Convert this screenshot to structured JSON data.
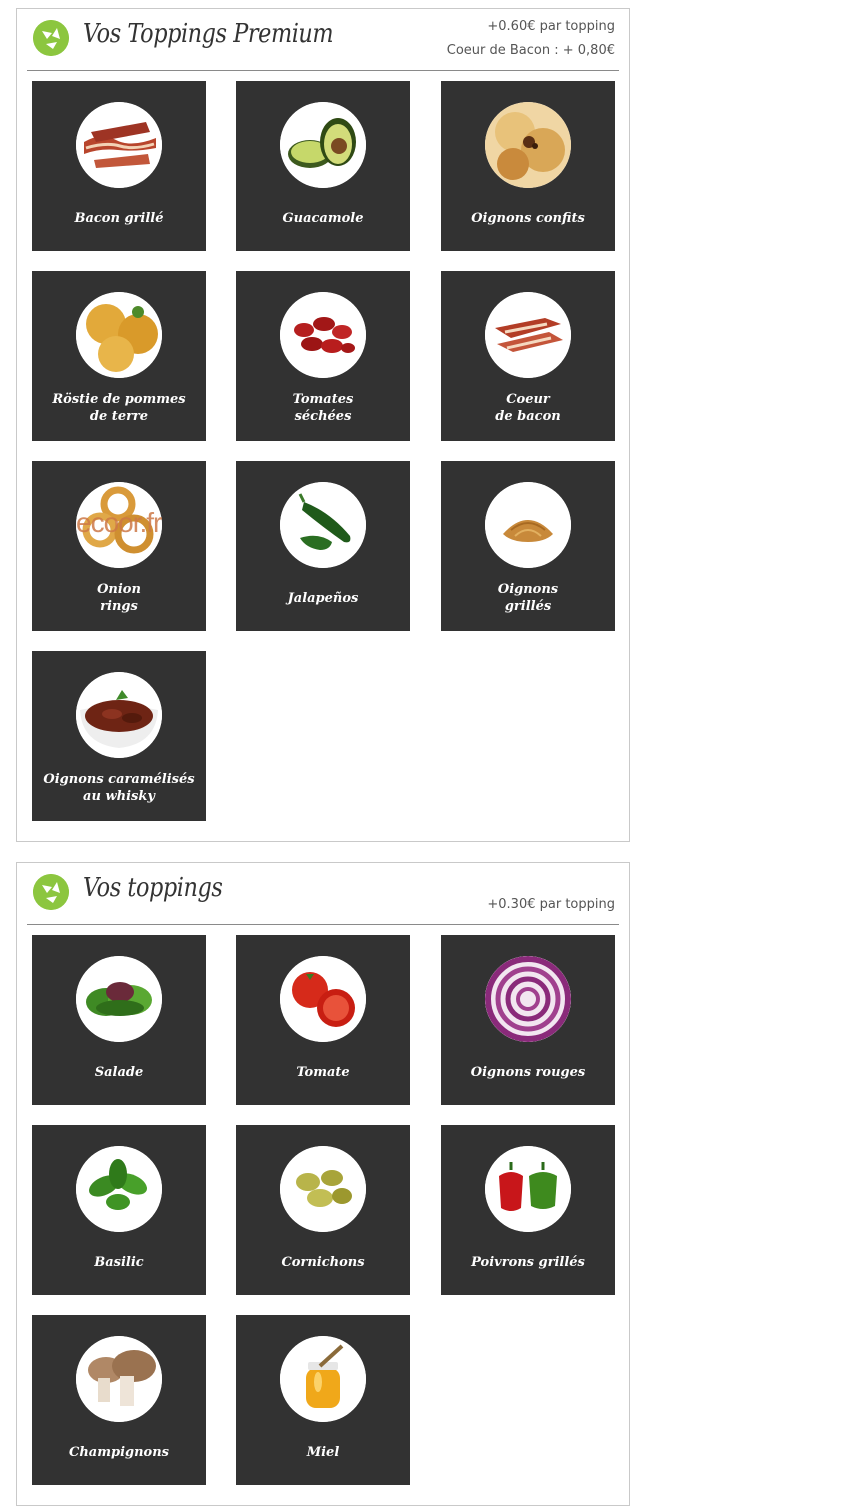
{
  "premium": {
    "title": "Vos Toppings Premium",
    "price_line_1": "+0.60€ par topping",
    "price_line_2": "Coeur de Bacon : + 0,80€",
    "items": [
      {
        "label": "Bacon grillé",
        "icon": "bacon-icon"
      },
      {
        "label": "Guacamole",
        "icon": "avocado-icon"
      },
      {
        "label": "Oignons confits",
        "icon": "confit-onion-icon"
      },
      {
        "label": "Röstie de pommes\nde terre",
        "icon": "rosti-icon"
      },
      {
        "label": "Tomates\nséchées",
        "icon": "dried-tomato-icon"
      },
      {
        "label": "Coeur\nde bacon",
        "icon": "bacon-heart-icon"
      },
      {
        "label": "Onion\nrings",
        "icon": "onion-rings-icon"
      },
      {
        "label": "Jalapeños",
        "icon": "jalapeno-icon"
      },
      {
        "label": "Oignons\ngrillés",
        "icon": "fried-onion-icon"
      },
      {
        "label": "Oignons caramélisés\nau whisky",
        "icon": "caramelized-onion-icon"
      }
    ],
    "watermark": "ecoor.fr"
  },
  "standard": {
    "title": "Vos toppings",
    "price_line_1": "+0.30€ par topping",
    "items": [
      {
        "label": "Salade",
        "icon": "lettuce-icon"
      },
      {
        "label": "Tomate",
        "icon": "tomato-icon"
      },
      {
        "label": "Oignons rouges",
        "icon": "red-onion-icon"
      },
      {
        "label": "Basilic",
        "icon": "basil-icon"
      },
      {
        "label": "Cornichons",
        "icon": "pickle-icon"
      },
      {
        "label": "Poivrons grillés",
        "icon": "pepper-icon"
      },
      {
        "label": "Champignons",
        "icon": "mushroom-icon"
      },
      {
        "label": "Miel",
        "icon": "honey-icon"
      }
    ]
  },
  "colors": {
    "tile_bg": "#323232",
    "logo_green": "#8cc63f",
    "border": "#c9c9c9"
  }
}
